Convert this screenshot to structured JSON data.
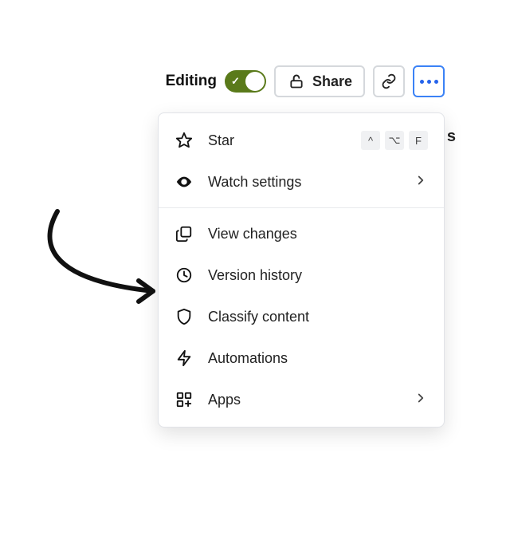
{
  "toolbar": {
    "editing_label": "Editing",
    "share_label": "Share"
  },
  "menu": {
    "star": {
      "label": "Star",
      "shortcut_keys": [
        "^",
        "⌥",
        "F"
      ]
    },
    "watch": {
      "label": "Watch settings"
    },
    "view_changes": {
      "label": "View changes"
    },
    "version_history": {
      "label": "Version history"
    },
    "classify": {
      "label": "Classify content"
    },
    "automations": {
      "label": "Automations"
    },
    "apps": {
      "label": "Apps"
    }
  },
  "edge_text": "s"
}
